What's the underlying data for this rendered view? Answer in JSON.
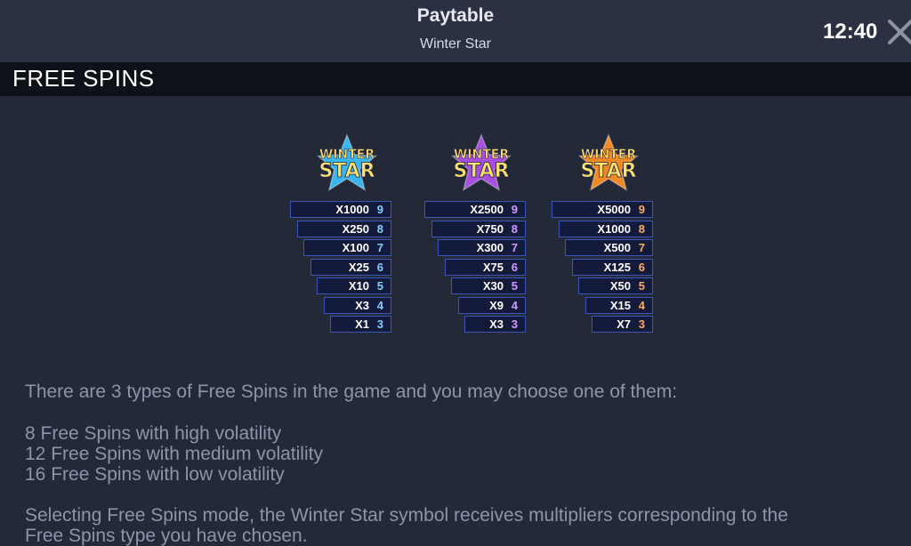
{
  "header": {
    "title": "Paytable",
    "subtitle": "Winter Star",
    "clock": "12:40"
  },
  "section": {
    "title": "FREE SPINS"
  },
  "symbol": {
    "line1": "WINTER",
    "line2": "STAR"
  },
  "tables": [
    {
      "variant": "blue",
      "star_color": "#39b6ee",
      "rows": [
        {
          "mult": "X1000",
          "count": "9"
        },
        {
          "mult": "X250",
          "count": "8"
        },
        {
          "mult": "X100",
          "count": "7"
        },
        {
          "mult": "X25",
          "count": "6"
        },
        {
          "mult": "X10",
          "count": "5"
        },
        {
          "mult": "X3",
          "count": "4"
        },
        {
          "mult": "X1",
          "count": "3"
        }
      ]
    },
    {
      "variant": "purple",
      "star_color": "#a84fe0",
      "rows": [
        {
          "mult": "X2500",
          "count": "9"
        },
        {
          "mult": "X750",
          "count": "8"
        },
        {
          "mult": "X300",
          "count": "7"
        },
        {
          "mult": "X75",
          "count": "6"
        },
        {
          "mult": "X30",
          "count": "5"
        },
        {
          "mult": "X9",
          "count": "4"
        },
        {
          "mult": "X3",
          "count": "3"
        }
      ]
    },
    {
      "variant": "orange",
      "star_color": "#f08a24",
      "rows": [
        {
          "mult": "X5000",
          "count": "9"
        },
        {
          "mult": "X1000",
          "count": "8"
        },
        {
          "mult": "X500",
          "count": "7"
        },
        {
          "mult": "X125",
          "count": "6"
        },
        {
          "mult": "X50",
          "count": "5"
        },
        {
          "mult": "X15",
          "count": "4"
        },
        {
          "mult": "X7",
          "count": "3"
        }
      ]
    }
  ],
  "description": {
    "intro": "There are 3 types of Free Spins in the game and you may choose one of them:",
    "option1": "8 Free Spins with high volatility",
    "option2": "12 Free Spins with medium volatility",
    "option3": "16 Free Spins with low volatility",
    "footer_line1": "Selecting Free Spins mode, the Winter Star symbol receives multipliers corresponding to the",
    "footer_line2": "Free Spins type you have chosen."
  },
  "colors": {
    "count_colors": {
      "blue": "#7fd0ff",
      "purple": "#d49bff",
      "orange": "#ffab5a"
    },
    "row_border": "#3b56b8",
    "row_fill": "#131a3a"
  }
}
